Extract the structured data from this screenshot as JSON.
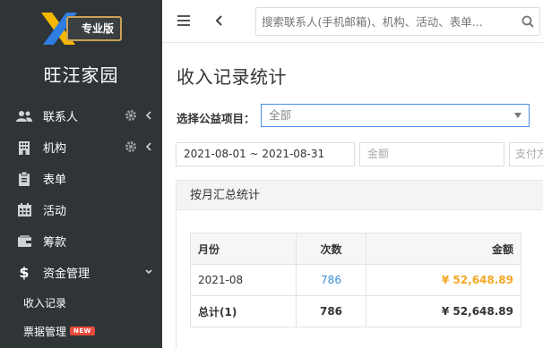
{
  "brand": {
    "badge_label": "专业版",
    "org_name": "旺汪家园",
    "colors": {
      "x_yellow": "#f5b800",
      "x_blue": "#2f7de1",
      "badge_border": "#c9a15a"
    }
  },
  "sidebar": {
    "items": [
      {
        "label": "联系人",
        "icon": "contacts-icon",
        "has_gear": true,
        "chevron": "left"
      },
      {
        "label": "机构",
        "icon": "building-icon",
        "has_gear": true,
        "chevron": "left"
      },
      {
        "label": "表单",
        "icon": "clipboard-icon"
      },
      {
        "label": "活动",
        "icon": "calendar-icon"
      },
      {
        "label": "筹款",
        "icon": "wallet-icon"
      },
      {
        "label": "资金管理",
        "icon": "dollar-icon",
        "chevron": "down"
      }
    ],
    "sub_items": [
      {
        "label": "收入记录"
      },
      {
        "label": "票据管理",
        "badge": "NEW"
      }
    ]
  },
  "topbar": {
    "search_placeholder": "搜索联系人(手机邮箱)、机构、活动、表单..."
  },
  "main": {
    "title": "收入记录统计",
    "project_label": "选择公益项目：",
    "project_value": "全部",
    "date_range": "2021-08-01 ~ 2021-08-31",
    "amount_placeholder": "金额",
    "payment_placeholder": "支付方式",
    "panel_title": "按月汇总统计",
    "table": {
      "headers": {
        "month": "月份",
        "count": "次数",
        "amount": "金额"
      },
      "rows": [
        {
          "month": "2021-08",
          "count": "786",
          "amount": "¥ 52,648.89"
        }
      ],
      "total": {
        "label": "总计(1)",
        "count": "786",
        "amount": "¥ 52,648.89"
      }
    }
  }
}
